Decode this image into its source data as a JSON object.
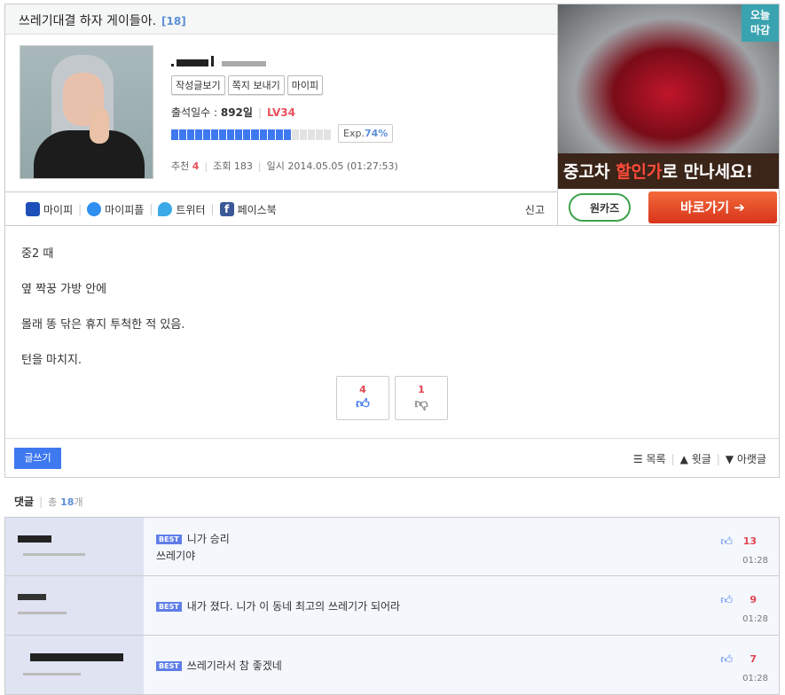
{
  "post": {
    "title": "쓰레기대결 하자 게이들아.",
    "comment_count": "[18]"
  },
  "profile": {
    "buttons": [
      "작성글보기",
      "쪽지 보내기",
      "마이피"
    ],
    "attendance_label": "출석일수 :",
    "attendance_value": "892일",
    "level": "LV34",
    "exp_label": "Exp.",
    "exp_value": "74%",
    "exp_fraction": 0.74,
    "recommend_label": "추천",
    "recommend_value": "4",
    "views_label": "조회",
    "views_value": "183",
    "date_label": "일시",
    "date_value": "2014.05.05 (01:27:53)"
  },
  "share": {
    "items": [
      "마이피",
      "마이피플",
      "트위터",
      "페이스북"
    ],
    "report": "신고"
  },
  "ad": {
    "badge": "오늘\n마감",
    "banner_a": "중고차 ",
    "banner_b": "할인가",
    "banner_c": "로 만나세요!",
    "logo": "원카즈",
    "go": "바로가기 ➔"
  },
  "body": {
    "lines": [
      "중2 때",
      "옆 짝꿍 가방 안에",
      "몰래 똥 닦은 휴지 투척한 적 있음.",
      "턴을 마치지."
    ],
    "up": "4",
    "down": "1"
  },
  "bottom": {
    "write": "글쓰기",
    "list": "목록",
    "prev": "윗글",
    "next": "아랫글"
  },
  "comments": {
    "title": "댓글",
    "total_label": "총",
    "total": "18",
    "unit": "개",
    "badge": "BEST",
    "items": [
      {
        "text": "니가 승리",
        "text2": "쓰레기야",
        "votes": "13",
        "time": "01:28"
      },
      {
        "text": "내가 졌다. 니가 이 동네 최고의 쓰레기가 되어라",
        "votes": "9",
        "time": "01:28"
      },
      {
        "text": "쓰레기라서 참 좋겠네",
        "votes": "7",
        "time": "01:28"
      }
    ]
  }
}
